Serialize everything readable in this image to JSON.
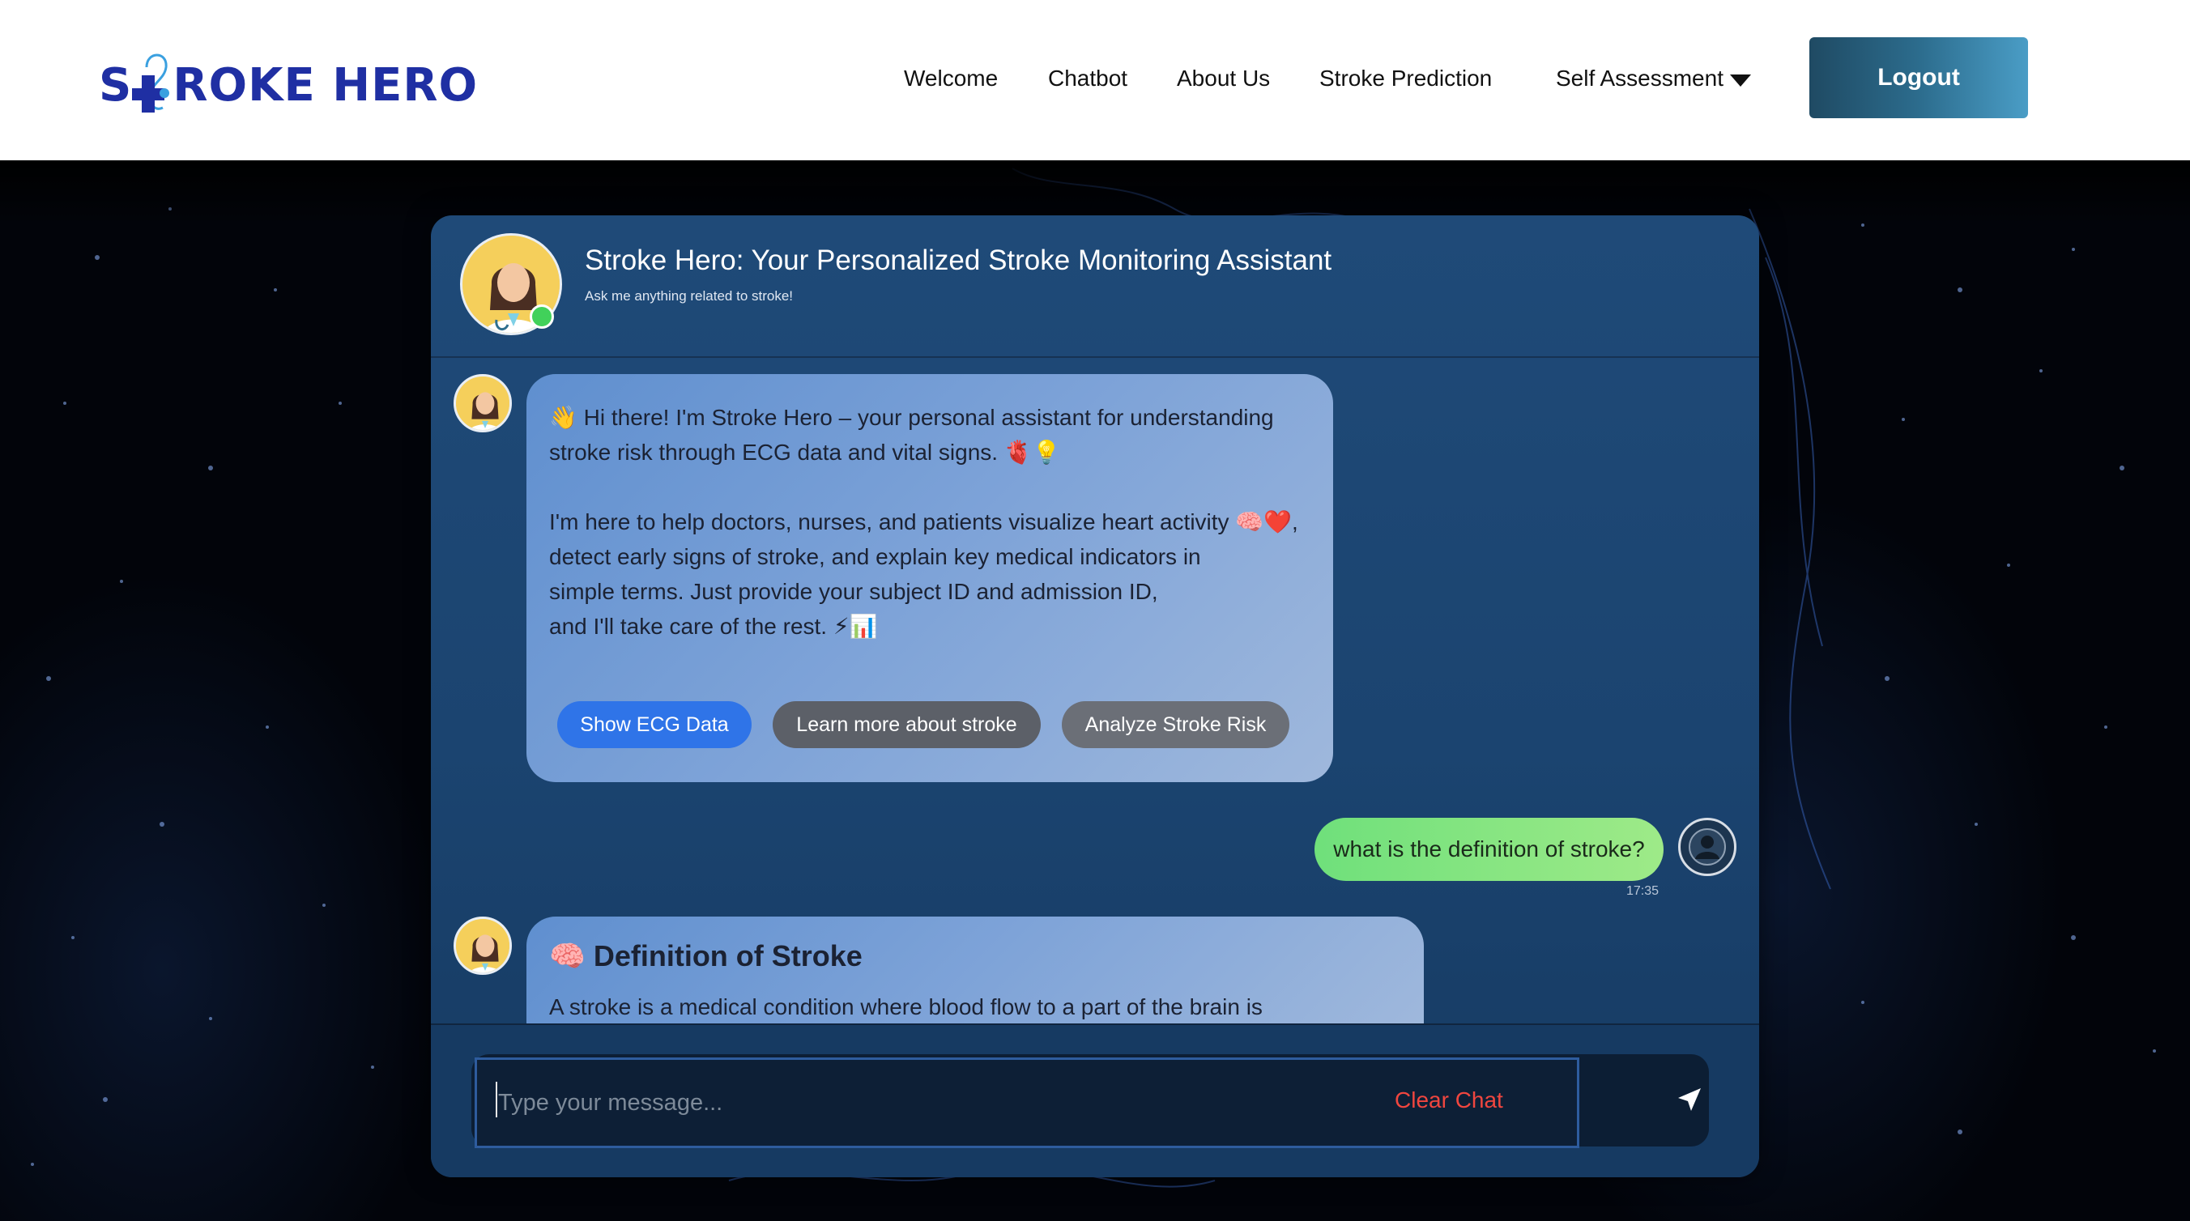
{
  "brand": {
    "name_part1": "S",
    "name_part2": "ROKE HERO",
    "logo_color": "#1f2fa3",
    "accent_color": "#3aa0e0"
  },
  "nav": {
    "links": [
      "Welcome",
      "Chatbot",
      "About Us",
      "Stroke Prediction",
      "Self Assessment"
    ],
    "dropdown_icon": "caret-down-icon",
    "logout_label": "Logout"
  },
  "chat": {
    "title": "Stroke Hero: Your Personalized Stroke Monitoring Assistant",
    "subtitle": "Ask me anything related to stroke!",
    "status": "online",
    "welcome_message": {
      "line1": "👋 Hi there! I'm Stroke Hero – your personal assistant for understanding",
      "line2": "stroke risk through ECG data and vital signs. 🫀💡",
      "line3": "I'm here to help doctors, nurses, and patients visualize heart activity 🧠❤️,",
      "line4": "detect early signs of stroke, and explain key medical indicators in",
      "line5": "simple terms. Just provide your subject ID and admission ID,",
      "line6": "and I'll take care of the rest. ⚡📊"
    },
    "quick_actions": [
      "Show ECG Data",
      "Learn more about stroke",
      "Analyze Stroke Risk"
    ],
    "user_message": {
      "text": "what is the definition of stroke?",
      "time": "17:35"
    },
    "definition_reply": {
      "icon": "🧠",
      "title": "Definition of Stroke",
      "body": "A stroke is a medical condition where blood flow to a part of the brain is"
    },
    "input": {
      "placeholder": "Type your message...",
      "value": ""
    },
    "clear_label": "Clear Chat"
  },
  "colors": {
    "primary_button": "#2f74e8",
    "user_bubble": "#6fe07b",
    "clear_chat": "#f0463f",
    "panel_bg": "#1f4a78"
  }
}
